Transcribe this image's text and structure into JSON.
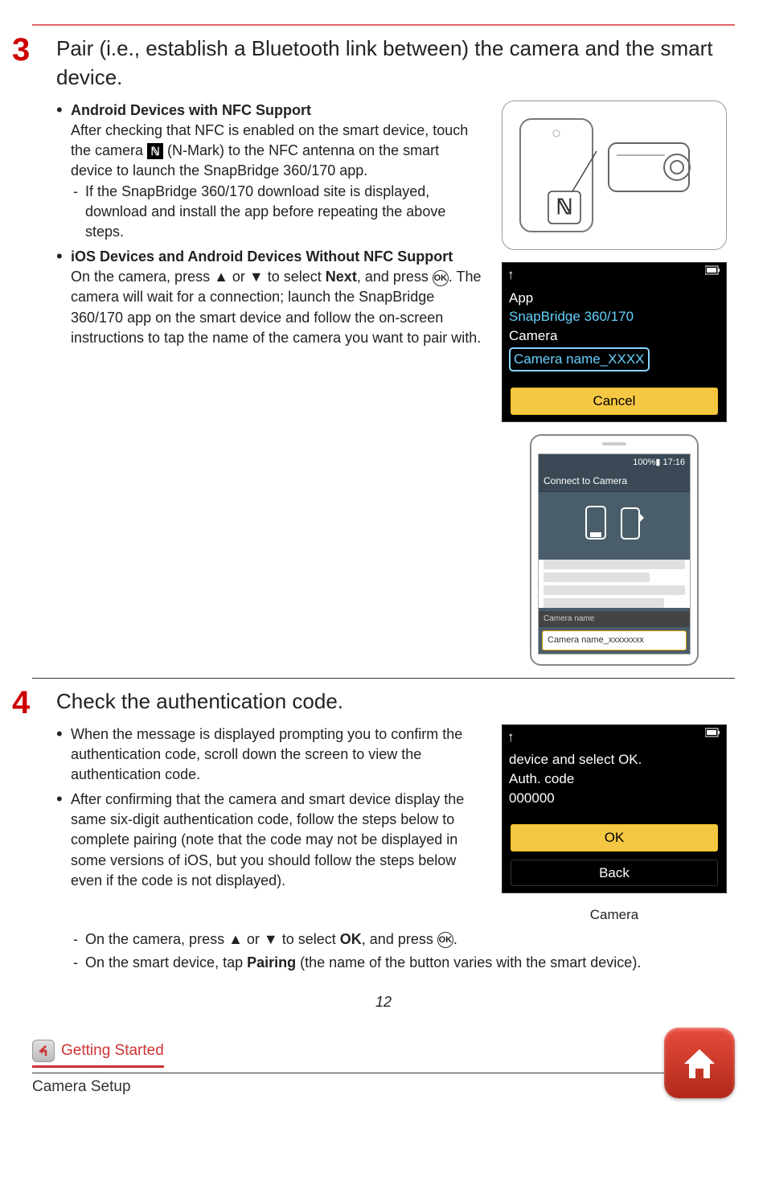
{
  "step3": {
    "number": "3",
    "title": "Pair (i.e., establish a Bluetooth link between) the camera and the smart device.",
    "bullet1_title": "Android Devices with NFC Support",
    "bullet1_text_a": "After checking that NFC is enabled on the smart device, touch the camera ",
    "bullet1_text_b": " (N-Mark) to the NFC antenna on the smart device to launch the SnapBridge 360/170 app.",
    "bullet1_dash1": "If the SnapBridge 360/170 download site is displayed, download and install the app before repeating the above steps.",
    "bullet2_title": "iOS Devices and Android Devices Without NFC Support",
    "bullet2_text_a": "On the camera, press ",
    "bullet2_text_b": " or ",
    "bullet2_text_c": " to select ",
    "bullet2_next": "Next",
    "bullet2_text_d": ", and press ",
    "bullet2_ok": "OK",
    "bullet2_text_e": ". The camera will wait for a connection; launch the SnapBridge 360/170 app on the smart device and follow the on-screen instructions to tap the name of the camera you want to pair with."
  },
  "lcd1": {
    "line1": "App",
    "line2": "SnapBridge 360/170",
    "line3": "Camera",
    "line4": "Camera name_XXXX",
    "cancel": "Cancel"
  },
  "phone": {
    "time": "17:16",
    "batt": "100%",
    "title": "Connect to Camera",
    "camlabel": "Camera name",
    "camname": "Camera name_xxxxxxxx"
  },
  "step4": {
    "number": "4",
    "title": "Check the authentication code.",
    "bullet1": "When the message is displayed prompting you to confirm the authentication code, scroll down the screen to view the authentication code.",
    "bullet2": "After confirming that the camera and smart device display the same six-digit authentication code, follow the steps below to complete pairing (note that the code may not be displayed in some versions of iOS, but you should follow the steps below even if the code is not displayed).",
    "dash1_a": "On the camera, press ",
    "dash1_b": " or ",
    "dash1_c": " to select ",
    "dash1_ok": "OK",
    "dash1_d": ", and press ",
    "dash1_okicon": "OK",
    "dash1_e": ".",
    "dash2_a": "On the smart device, tap ",
    "dash2_pairing": "Pairing",
    "dash2_b": " (the name of the button varies with the smart device)."
  },
  "lcd2": {
    "line1": "device and select OK.",
    "line2": "Auth. code",
    "line3": "000000",
    "ok": "OK",
    "back": "Back",
    "caption": "Camera"
  },
  "pageNum": "12",
  "footer": {
    "link": "Getting Started",
    "sub": "Camera Setup"
  },
  "nmark_glyph": "ℕ"
}
